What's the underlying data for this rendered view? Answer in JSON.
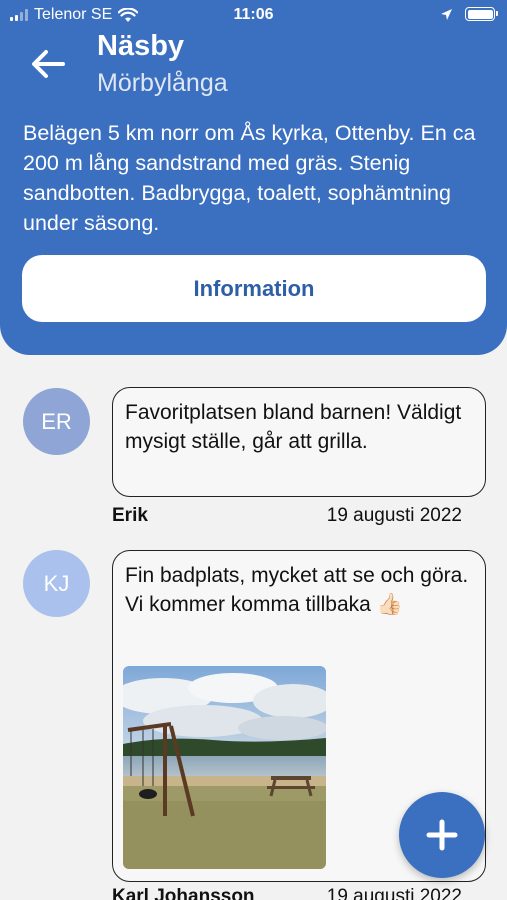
{
  "status_bar": {
    "carrier": "Telenor SE",
    "time": "11:06"
  },
  "header": {
    "title": "Näsby",
    "subtitle": "Mörbylånga",
    "description": "Belägen 5 km norr om Ås kyrka, Ottenby. En ca 200 m lång sandstrand med gräs. Stenig sandbotten. Badbrygga, toalett, sophämtning under säsong.",
    "info_button": "Information"
  },
  "comments": [
    {
      "initials": "ER",
      "text": "Favoritplatsen bland barnen! Väldigt mysigt ställe, går att grilla.",
      "author": "Erik",
      "date": "19 augusti 2022",
      "avatar_color": "#8ea5d6"
    },
    {
      "initials": "KJ",
      "text": "Fin badplats, mycket att se och göra. Vi kommer komma tillbaka 👍🏻",
      "author": "Karl Johansson",
      "date": "19 augusti 2022",
      "avatar_color": "#a9c1ec",
      "has_photo": true
    }
  ],
  "colors": {
    "primary": "#3b6fc0",
    "background": "#f2f2f2"
  },
  "icons": {
    "back": "arrow-left-icon",
    "add": "plus-icon"
  }
}
